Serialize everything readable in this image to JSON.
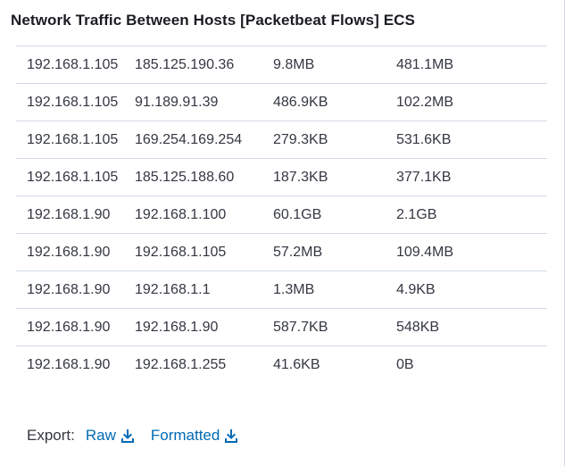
{
  "panel": {
    "title": "Network Traffic Between Hosts [Packetbeat Flows] ECS"
  },
  "table": {
    "rows": [
      [
        "192.168.1.105",
        "185.125.190.36",
        "9.8MB",
        "481.1MB"
      ],
      [
        "192.168.1.105",
        "91.189.91.39",
        "486.9KB",
        "102.2MB"
      ],
      [
        "192.168.1.105",
        "169.254.169.254",
        "279.3KB",
        "531.6KB"
      ],
      [
        "192.168.1.105",
        "185.125.188.60",
        "187.3KB",
        "377.1KB"
      ],
      [
        "192.168.1.90",
        "192.168.1.100",
        "60.1GB",
        "2.1GB"
      ],
      [
        "192.168.1.90",
        "192.168.1.105",
        "57.2MB",
        "109.4MB"
      ],
      [
        "192.168.1.90",
        "192.168.1.1",
        "1.3MB",
        "4.9KB"
      ],
      [
        "192.168.1.90",
        "192.168.1.90",
        "587.7KB",
        "548KB"
      ],
      [
        "192.168.1.90",
        "192.168.1.255",
        "41.6KB",
        "0B"
      ]
    ]
  },
  "export": {
    "label": "Export:",
    "raw_label": "Raw",
    "formatted_label": "Formatted",
    "icon": "download-icon",
    "link_color": "#006bb4"
  }
}
